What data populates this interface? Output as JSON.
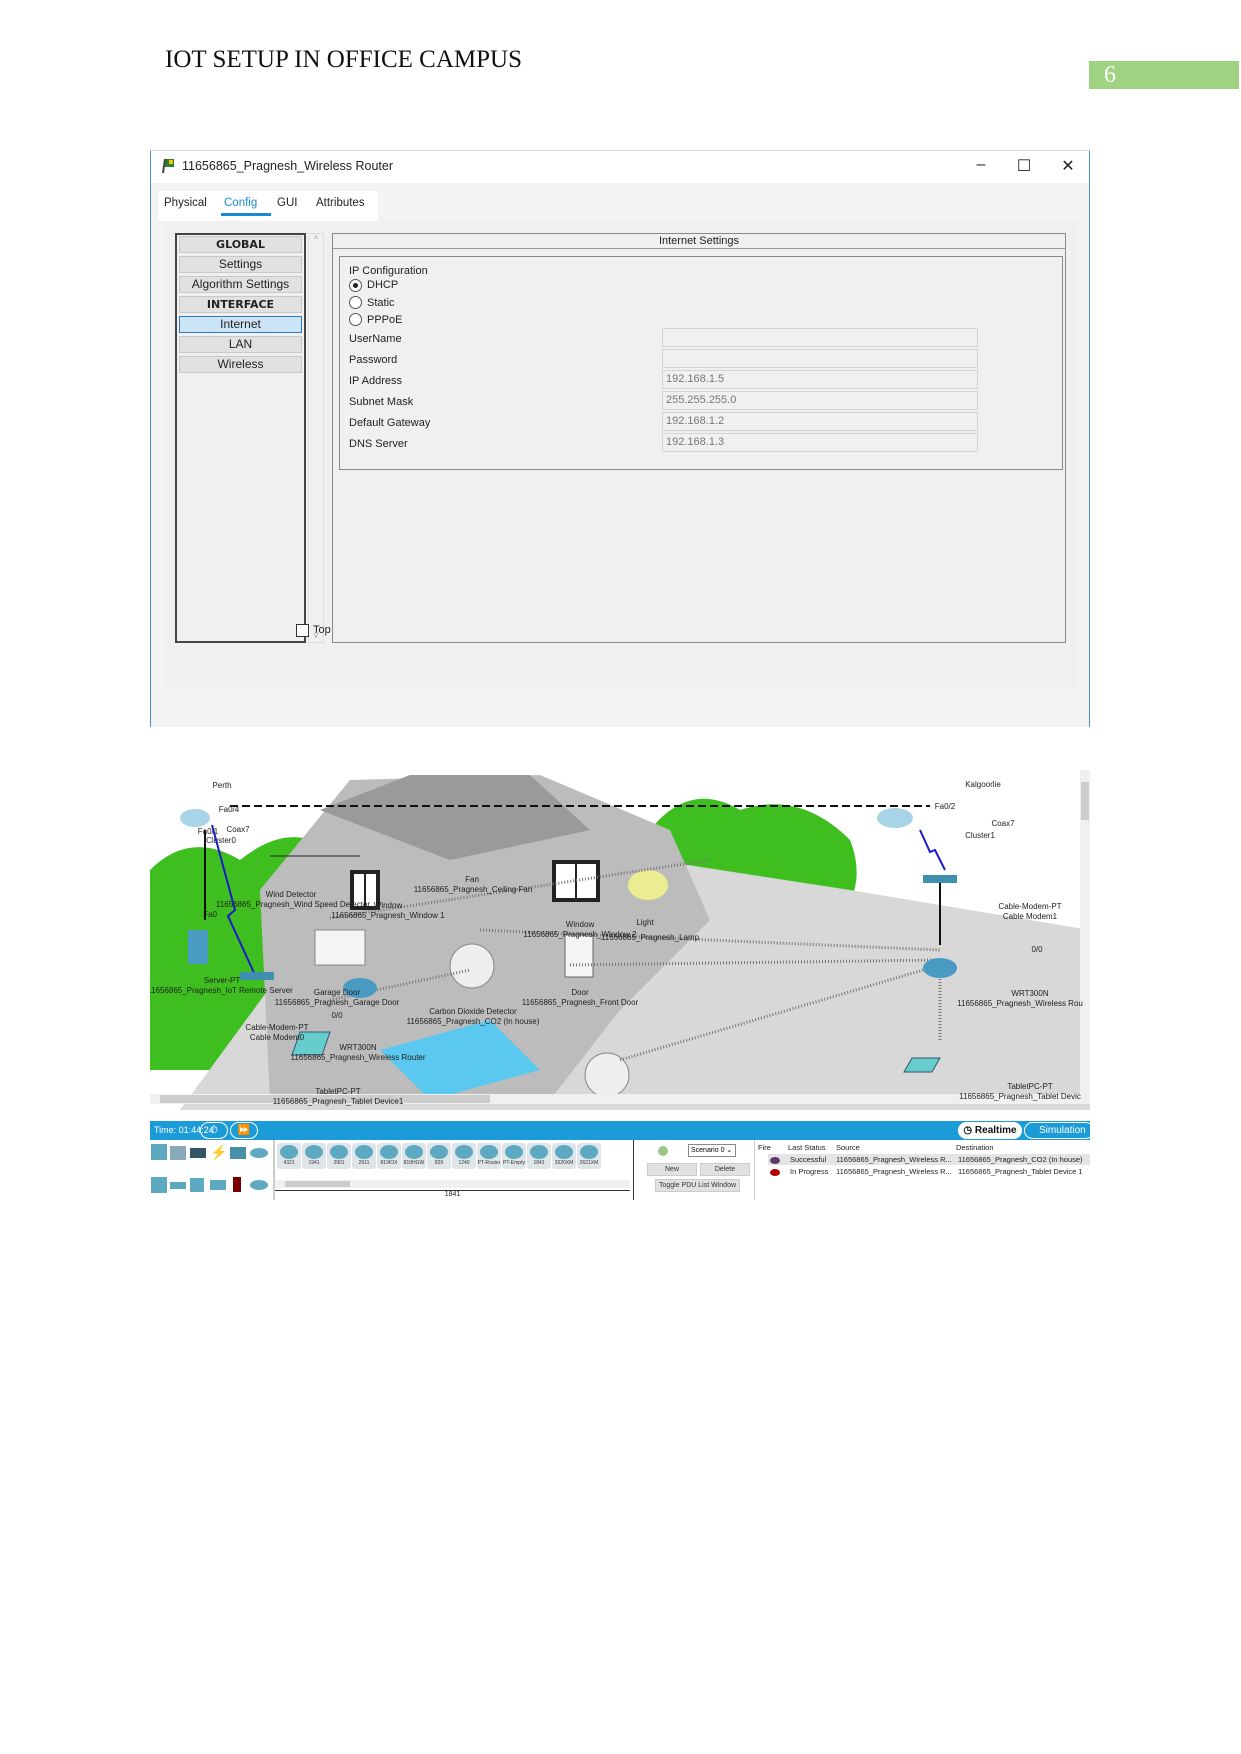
{
  "document": {
    "title": "IOT SETUP IN OFFICE CAMPUS",
    "page_number": "6",
    "accent": "#9fd383"
  },
  "window": {
    "title": "11656865_Pragnesh_Wireless Router",
    "minimize": "–",
    "maximize": "☐",
    "close": "✕",
    "tabs": [
      {
        "label": "Physical"
      },
      {
        "label": "Config",
        "active": true
      },
      {
        "label": "GUI"
      },
      {
        "label": "Attributes"
      }
    ],
    "sidebar": [
      {
        "label": "GLOBAL",
        "header": true
      },
      {
        "label": "Settings"
      },
      {
        "label": "Algorithm Settings"
      },
      {
        "label": "INTERFACE",
        "header": true
      },
      {
        "label": "Internet",
        "selected": true
      },
      {
        "label": "LAN"
      },
      {
        "label": "Wireless"
      }
    ],
    "panel_title": "Internet Settings",
    "ip_config_label": "IP Configuration",
    "radios": [
      {
        "label": "DHCP",
        "checked": true
      },
      {
        "label": "Static",
        "checked": false
      },
      {
        "label": "PPPoE",
        "checked": false
      }
    ],
    "fields": [
      {
        "label": "UserName",
        "value": ""
      },
      {
        "label": "Password",
        "value": ""
      },
      {
        "label": "IP Address",
        "value": "192.168.1.5"
      },
      {
        "label": "Subnet Mask",
        "value": "255.255.255.0"
      },
      {
        "label": "Default Gateway",
        "value": "192.168.1.2"
      },
      {
        "label": "DNS Server",
        "value": "192.168.1.3"
      }
    ],
    "top_checkbox": {
      "label": "Top",
      "checked": false
    }
  },
  "scene": {
    "labels": [
      "Perth",
      "Kalgoorlie",
      "Fa0/4",
      "Fa0/1",
      "Coax7",
      "Cluster0",
      "Fa0/2",
      "Coax7",
      "Cluster1",
      "Wind Detector",
      "11656865_Pragnesh_Wind Speed Detector",
      "Window",
      "11656865_Pragnesh_Window 1",
      "Fa0",
      "Fan",
      "11656865_Pragnesh_Ceiling Fan",
      "Window",
      "11656865_Pragnesh_Window 2",
      "Light",
      "11656865_Pragnesh_Lamp",
      "Door",
      "11656865_Pragnesh_Front Door",
      "Carbon Dioxide Detector",
      "11656865_Pragnesh_CO2 (In house)",
      "Server-PT",
      "11656865_Pragnesh_IoT Remote Server",
      "Garage Door",
      "11656865_Pragnesh_Garage Door",
      "Cable-Modem-PT",
      "Cable Modem0",
      "0/0",
      "WRT300N",
      "11656865_Pragnesh_Wireless Router",
      "TabletPC-PT",
      "11656865_Pragnesh_Tablet Device1",
      "Cable-Modem-PT",
      "Cable Modem1",
      "0/0",
      "WRT300N",
      "11656865_Pragnesh_Wireless Rou",
      "TabletPC-PT",
      "11656865_Pragnesh_Tablet Devic"
    ]
  },
  "statusbar": {
    "time": "Time: 01:44:24",
    "realtime": "Realtime",
    "simulation": "Simulation"
  },
  "devices": [
    "4321",
    "1941",
    "2901",
    "2911",
    "819IOX",
    "819HGW",
    "829",
    "1240",
    "PT-Router",
    "PT-Empty",
    "1841",
    "2620XM",
    "2621XM"
  ],
  "selected_device": "1841",
  "scenario": {
    "select": "Scenario 0",
    "new": "New",
    "delete": "Delete",
    "toggle": "Toggle PDU List Window"
  },
  "pdu_table": {
    "headers": [
      "Fire",
      "Last Status",
      "Source",
      "Destination"
    ],
    "rows": [
      {
        "color": "#5a3a6a",
        "status": "Successful",
        "source": "11656865_Pragnesh_Wireless R...",
        "destination": "11656865_Pragnesh_CO2 (In house)"
      },
      {
        "color": "#b00000",
        "status": "In Progress",
        "source": "11656865_Pragnesh_Wireless R...",
        "destination": "11656865_Pragnesh_Tablet Device 1"
      }
    ]
  }
}
